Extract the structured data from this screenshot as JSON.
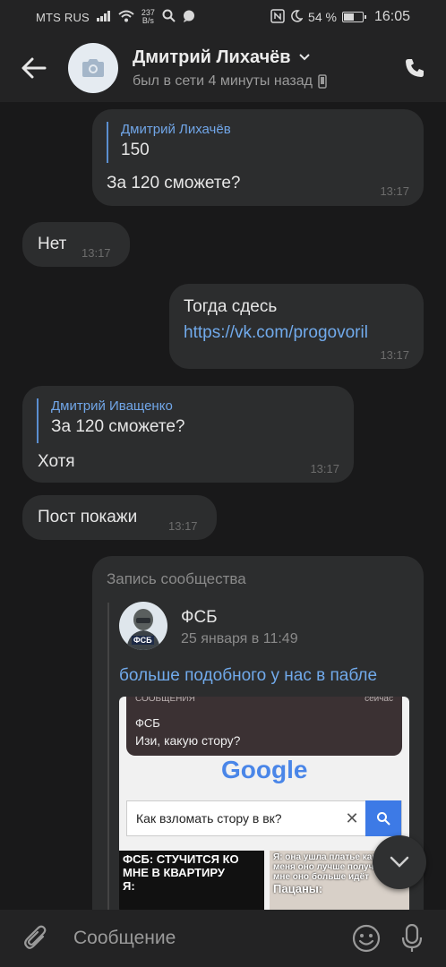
{
  "status_bar": {
    "carrier": "MTS RUS",
    "speed_value": "237",
    "speed_unit": "B/s",
    "battery": "54 %",
    "battery_level": 0.54,
    "time": "16:05"
  },
  "header": {
    "name": "Дмитрий Лихачёв",
    "status": "был в сети 4 минуты назад"
  },
  "messages": [
    {
      "quote_name": "Дмитрий Лихачёв",
      "quote_text": "150",
      "text": "За 120 сможете?",
      "time": "13:17"
    },
    {
      "text": "Нет",
      "time": "13:17"
    },
    {
      "text": "Тогда сдесь",
      "link": "https://vk.com/progovoril",
      "time": "13:17"
    },
    {
      "quote_name": "Дмитрий Иващенко",
      "quote_text": "За 120 сможете?",
      "text": "Хотя",
      "time": "13:17"
    },
    {
      "text": "Пост покажи",
      "time": "13:17"
    }
  ],
  "post": {
    "header": "Запись сообщества",
    "author": "ФСБ",
    "date": "25 января в 11:49",
    "text": "больше подобного у нас в пабле",
    "avatar_badge": "ФСБ",
    "image": {
      "notif_app": "СООБЩЕНИЯ",
      "notif_when": "сейчас",
      "notif_sender": "ФСБ",
      "notif_text": "Изи, какую стору?",
      "logo": "Google",
      "search_query": "Как взломать стору в вк?",
      "meme_left": "ФСБ: СТУЧИТСЯ КО МНЕ В КВАРТИРУ",
      "meme_left_2": "Я:",
      "meme_right": "Я: она ушла платье как у меня оно лучше получ... Ко мне оно больше идёт",
      "meme_right_2": "Пацаны:"
    }
  },
  "composer": {
    "placeholder": "Сообщение"
  }
}
